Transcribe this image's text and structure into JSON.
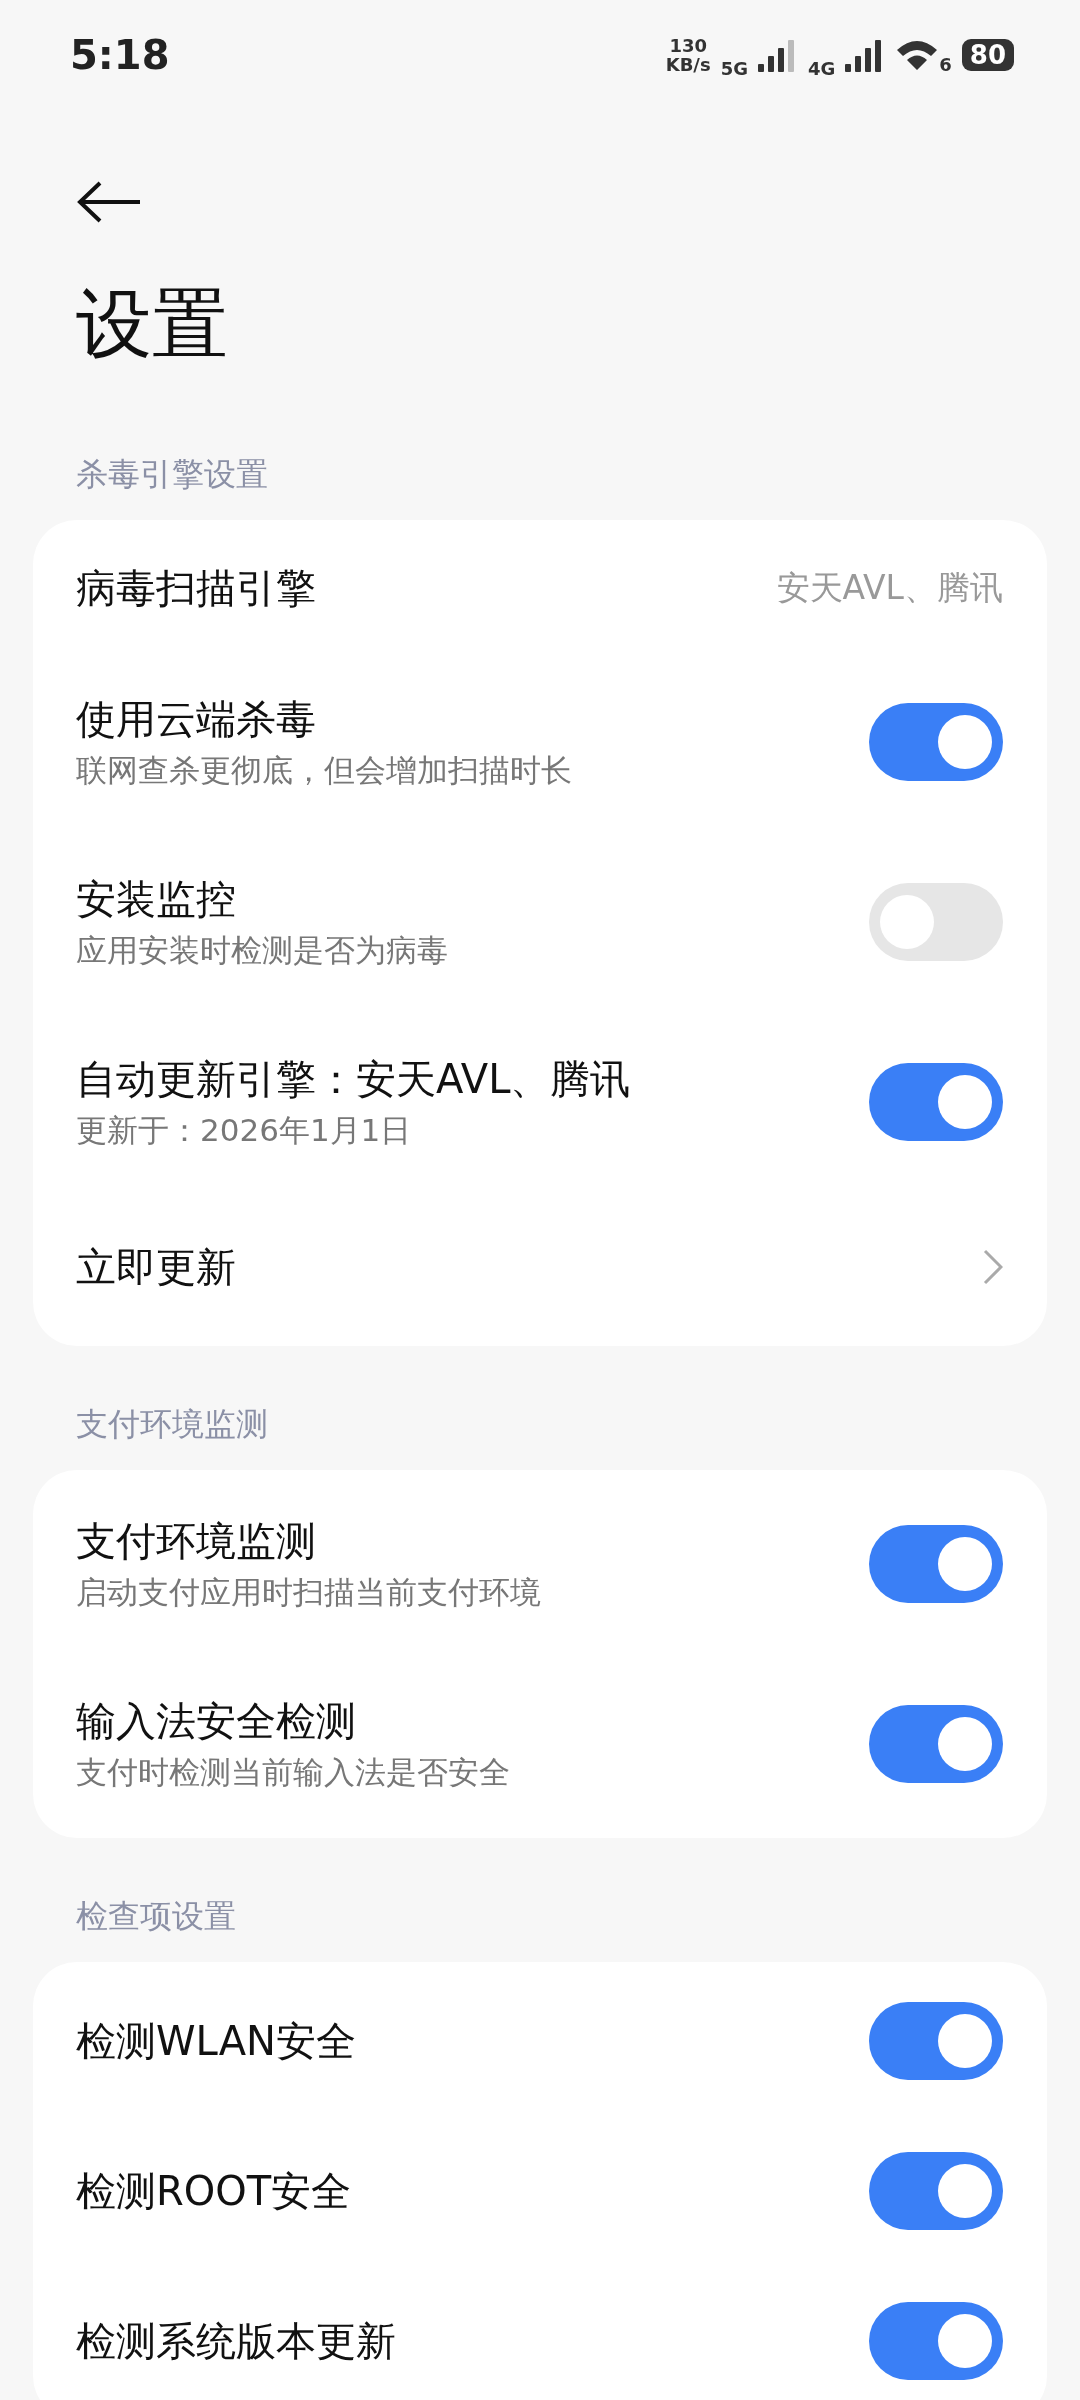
{
  "status_bar": {
    "time": "5:18",
    "speed_value": "130",
    "speed_unit": "KB/s",
    "sim1": "5G",
    "sim2": "4G",
    "wifi_label": "6",
    "battery": "80"
  },
  "title": "设置",
  "sections": [
    {
      "label": "杀毒引擎设置",
      "rows": [
        {
          "kind": "value",
          "title": "病毒扫描引擎",
          "value": "安天AVL、腾讯"
        },
        {
          "kind": "toggle",
          "title": "使用云端杀毒",
          "subtitle": "联网查杀更彻底，但会增加扫描时长",
          "on": true
        },
        {
          "kind": "toggle",
          "title": "安装监控",
          "subtitle": "应用安装时检测是否为病毒",
          "on": false
        },
        {
          "kind": "toggle",
          "title": "自动更新引擎：安天AVL、腾讯",
          "subtitle": "更新于：2026年1月1日",
          "on": true
        },
        {
          "kind": "link",
          "title": "立即更新"
        }
      ]
    },
    {
      "label": "支付环境监测",
      "rows": [
        {
          "kind": "toggle",
          "title": "支付环境监测",
          "subtitle": "启动支付应用时扫描当前支付环境",
          "on": true
        },
        {
          "kind": "toggle",
          "title": "输入法安全检测",
          "subtitle": "支付时检测当前输入法是否安全",
          "on": true
        }
      ]
    },
    {
      "label": "检查项设置",
      "rows": [
        {
          "kind": "toggle",
          "title": "检测WLAN安全",
          "on": true
        },
        {
          "kind": "toggle",
          "title": "检测ROOT安全",
          "on": true
        },
        {
          "kind": "toggle",
          "title": "检测系统版本更新",
          "on": true
        }
      ]
    }
  ]
}
